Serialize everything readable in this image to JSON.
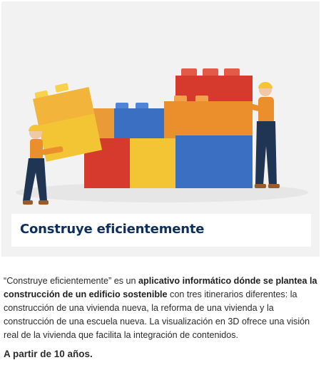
{
  "card": {
    "title": "Construye eficientemente",
    "desc_prefix": "“Construye eficientemente” es un ",
    "desc_bold": "aplicativo informático dónde se plantea la construcción de un edificio sostenible",
    "desc_suffix": " con tres itinerarios diferentes: la construcción de una vivienda nueva, la reforma de una vivienda y la construcción de una escuela nueva. La visualización en 3D ofrece una visión real de la vivienda que facilita la integración de contenidos.",
    "age": "A partir de 10 años."
  },
  "colors": {
    "title": "#0c2f5c",
    "hero_bg": "#f2f2f2",
    "block_red": "#d63a2c",
    "block_yellow": "#f3c534",
    "block_blue": "#3b6fc2",
    "block_orange": "#eb8f2c",
    "worker_navy": "#1f3553"
  },
  "icons": [
    "building-blocks-illustration",
    "construction-worker-icon"
  ]
}
